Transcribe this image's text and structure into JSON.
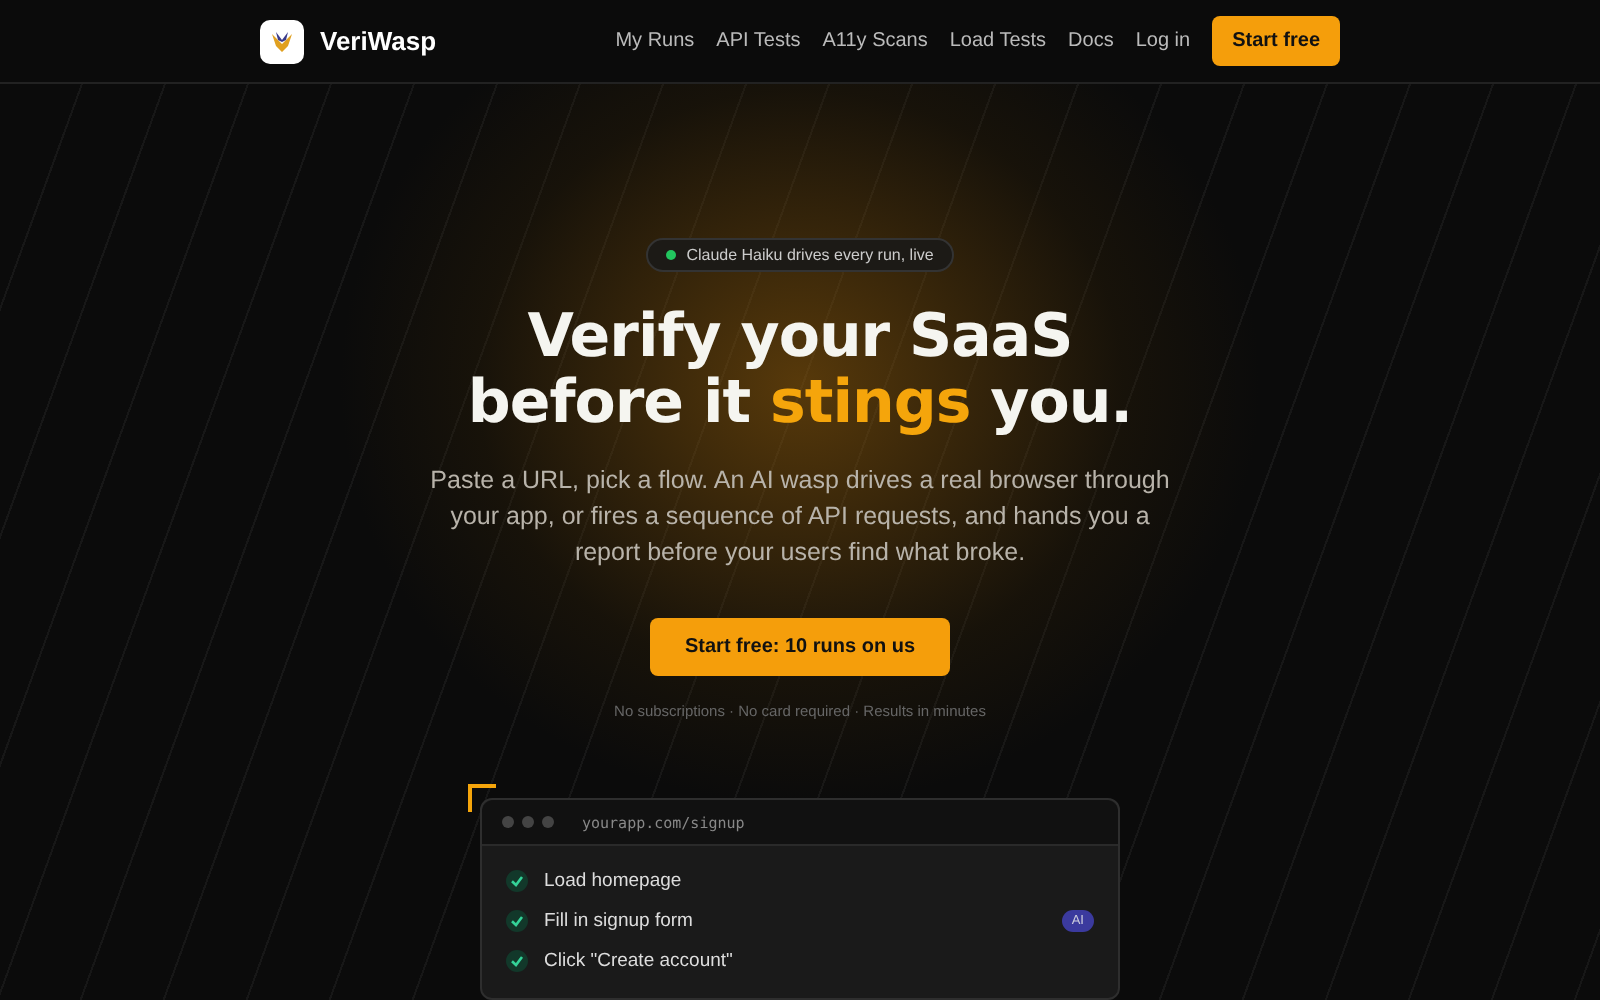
{
  "nav": {
    "brand": "VeriWasp",
    "links": [
      {
        "label": "My Runs"
      },
      {
        "label": "API Tests"
      },
      {
        "label": "A11y Scans"
      },
      {
        "label": "Load Tests"
      },
      {
        "label": "Docs"
      },
      {
        "label": "Log in"
      }
    ],
    "cta": "Start free"
  },
  "hero": {
    "badge": "Claude Haiku drives every run, live",
    "title_line1": "Verify your SaaS",
    "title_before": "before it ",
    "title_highlight": "stings",
    "title_after": " you.",
    "subtitle": "Paste a URL, pick a flow. An AI wasp drives a real browser through your app, or fires a sequence of API requests, and hands you a report before your users find what broke.",
    "cta": "Start free: 10 runs on us",
    "note": "No subscriptions · No card required · Results in minutes"
  },
  "preview": {
    "url": "yourapp.com/signup",
    "steps": [
      {
        "label": "Load homepage",
        "passed": true,
        "ai": false
      },
      {
        "label": "Fill in signup form",
        "passed": true,
        "ai": true,
        "ai_label": "AI"
      },
      {
        "label": "Click \"Create account\"",
        "passed": true,
        "ai": false
      }
    ]
  }
}
